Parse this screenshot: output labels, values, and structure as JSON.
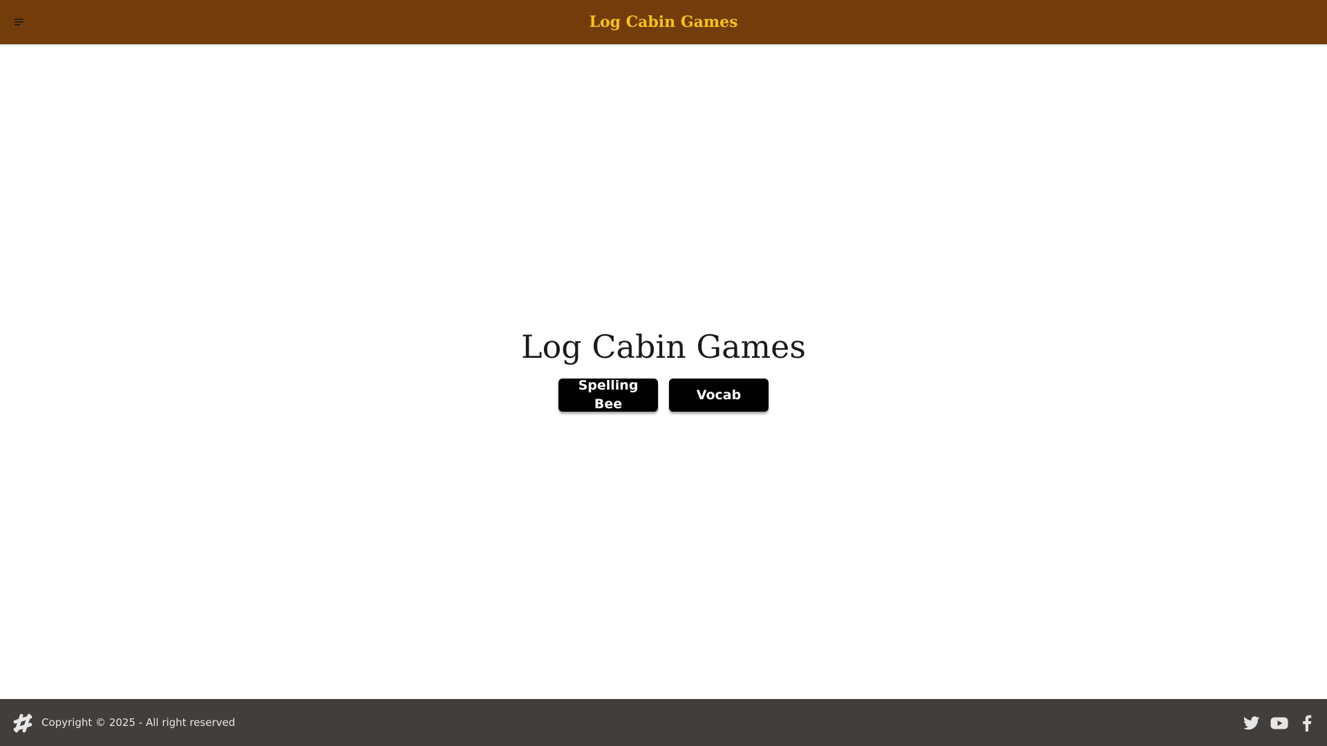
{
  "header": {
    "title": "Log Cabin Games",
    "menu_icon": "menu-icon"
  },
  "main": {
    "title": "Log Cabin Games",
    "buttons": [
      {
        "label": "Spelling Bee"
      },
      {
        "label": "Vocab"
      }
    ]
  },
  "footer": {
    "logo_icon": "hashtag-logo-icon",
    "copyright": "Copyright © 2025 - All right reserved",
    "social": [
      {
        "icon": "twitter-icon"
      },
      {
        "icon": "youtube-icon"
      },
      {
        "icon": "facebook-icon"
      }
    ]
  },
  "colors": {
    "header_bg": "#733c0b",
    "header_title": "#f5c218",
    "footer_bg": "#423e3b",
    "button_bg": "#000000",
    "button_text": "#ffffff"
  }
}
